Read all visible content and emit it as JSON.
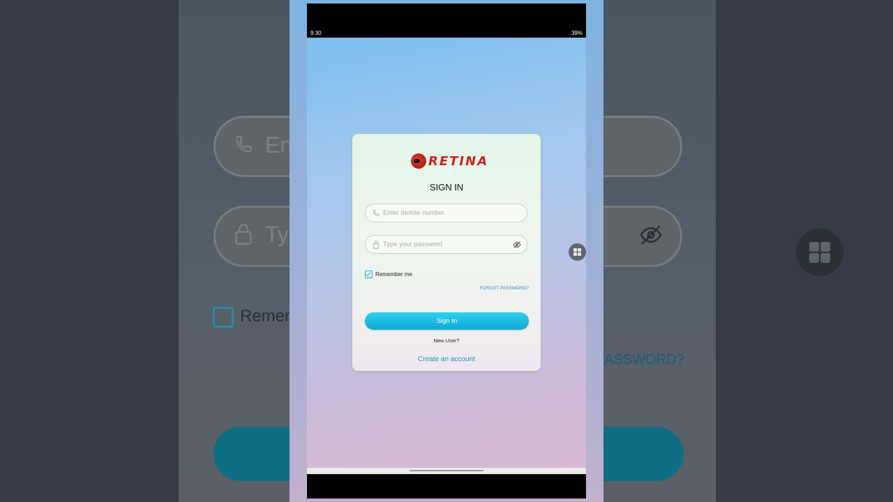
{
  "status_bar": {
    "time": "9:30",
    "battery": "39%"
  },
  "brand": {
    "name": "RETINA",
    "color": "#c8261b"
  },
  "signin": {
    "title": "SIGN IN",
    "mobile_placeholder": "Enter mobile number",
    "password_placeholder": "Type your password",
    "remember_label": "Remember me",
    "remember_checked": true,
    "forgot_label": "FORGOT PASSWORD?",
    "button_label": "Sign In",
    "new_user_label": "New User?",
    "create_account_label": "Create an account",
    "accent": "#0ea9d6"
  },
  "background": {
    "field_hint_1": "En",
    "field_hint_2": "Ty",
    "remember_partial": "Remem",
    "forgot_partial": "ASSWORD?"
  },
  "icons": [
    "phone-icon",
    "lock-icon",
    "eye-off-icon",
    "grid-icon"
  ]
}
